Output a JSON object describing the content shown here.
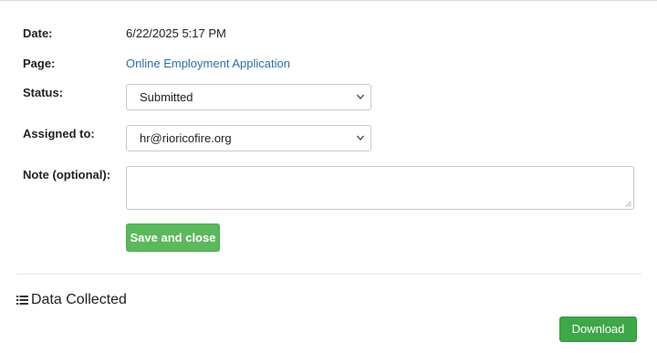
{
  "form": {
    "date_label": "Date:",
    "date_value": "6/22/2025 5:17 PM",
    "page_label": "Page:",
    "page_link": "Online Employment Application",
    "status_label": "Status:",
    "status_selected": "Submitted",
    "assigned_label": "Assigned to:",
    "assigned_selected": "hr@rioricofire.org",
    "note_label": "Note (optional):",
    "note_value": "",
    "save_label": "Save and close"
  },
  "data_collected": {
    "heading": "Data Collected",
    "icon": "list-icon",
    "download_label": "Download"
  },
  "colors": {
    "link": "#2f6ea3",
    "button_green": "#5cb85c",
    "download_green": "#3fa64a"
  }
}
